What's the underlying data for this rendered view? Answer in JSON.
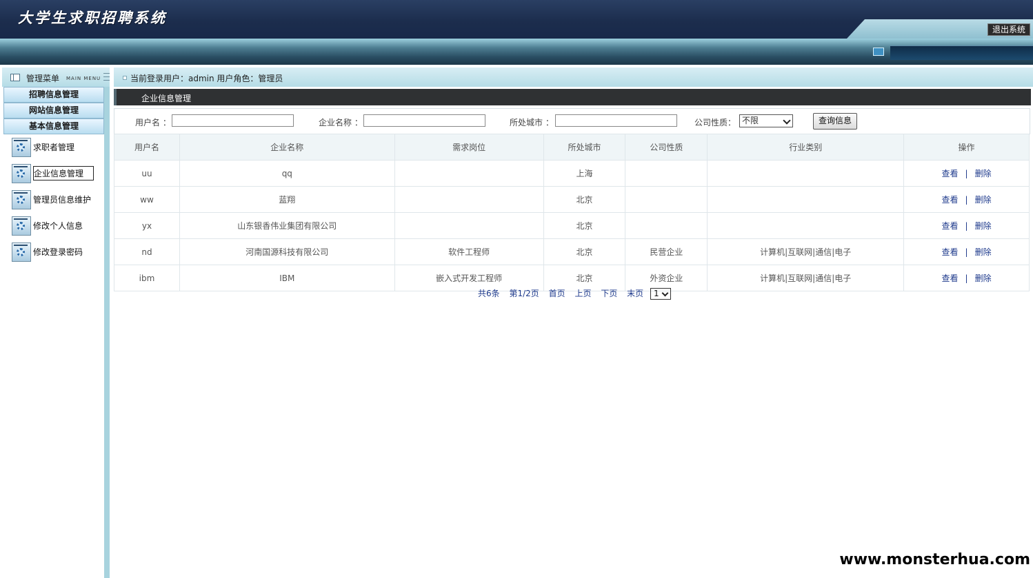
{
  "header": {
    "app_title": "大学生求职招聘系统",
    "logout_label": "退出系统"
  },
  "sidebar": {
    "title": "管理菜单",
    "subtitle": "MAIN MENU",
    "categories": [
      "招聘信息管理",
      "网站信息管理",
      "基本信息管理"
    ],
    "items": [
      {
        "label": "求职者管理",
        "icon": "gear-icon"
      },
      {
        "label": "企业信息管理",
        "icon": "gear-icon",
        "active": true
      },
      {
        "label": "管理员信息维护",
        "icon": "gear-icon"
      },
      {
        "label": "修改个人信息",
        "icon": "gear-icon"
      },
      {
        "label": "修改登录密码",
        "icon": "gear-icon"
      }
    ]
  },
  "topbar": {
    "login_info": "当前登录用户：admin  用户角色：管理员"
  },
  "panel": {
    "title": "企业信息管理"
  },
  "search": {
    "username_label": "用户名 ：",
    "company_label": "企业名称 ：",
    "city_label": "所处城市 ：",
    "nature_label": "公司性质：",
    "nature_selected": "不限",
    "query_button": "查询信息"
  },
  "table": {
    "columns": [
      "用户名",
      "企业名称",
      "需求岗位",
      "所处城市",
      "公司性质",
      "行业类别",
      "操作"
    ],
    "rows": [
      [
        "uu",
        "qq",
        "",
        "上海",
        "",
        ""
      ],
      [
        "ww",
        "蓝翔",
        "",
        "北京",
        "",
        ""
      ],
      [
        "yx",
        "山东银香伟业集团有限公司",
        "",
        "北京",
        "",
        ""
      ],
      [
        "nd",
        "河南国源科技有限公司",
        "软件工程师",
        "北京",
        "民营企业",
        "计算机|互联网|通信|电子"
      ],
      [
        "ibm",
        "IBM",
        "嵌入式开发工程师",
        "北京",
        "外资企业",
        "计算机|互联网|通信|电子"
      ]
    ],
    "action_view": "查看",
    "action_separator": "|",
    "action_delete": "删除"
  },
  "pager": {
    "total": "共6条",
    "page_info": "第1/2页",
    "first": "首页",
    "prev": "上页",
    "next": "下页",
    "last": "末页",
    "current_page": "1"
  },
  "watermark": "www.monsterhua.com"
}
